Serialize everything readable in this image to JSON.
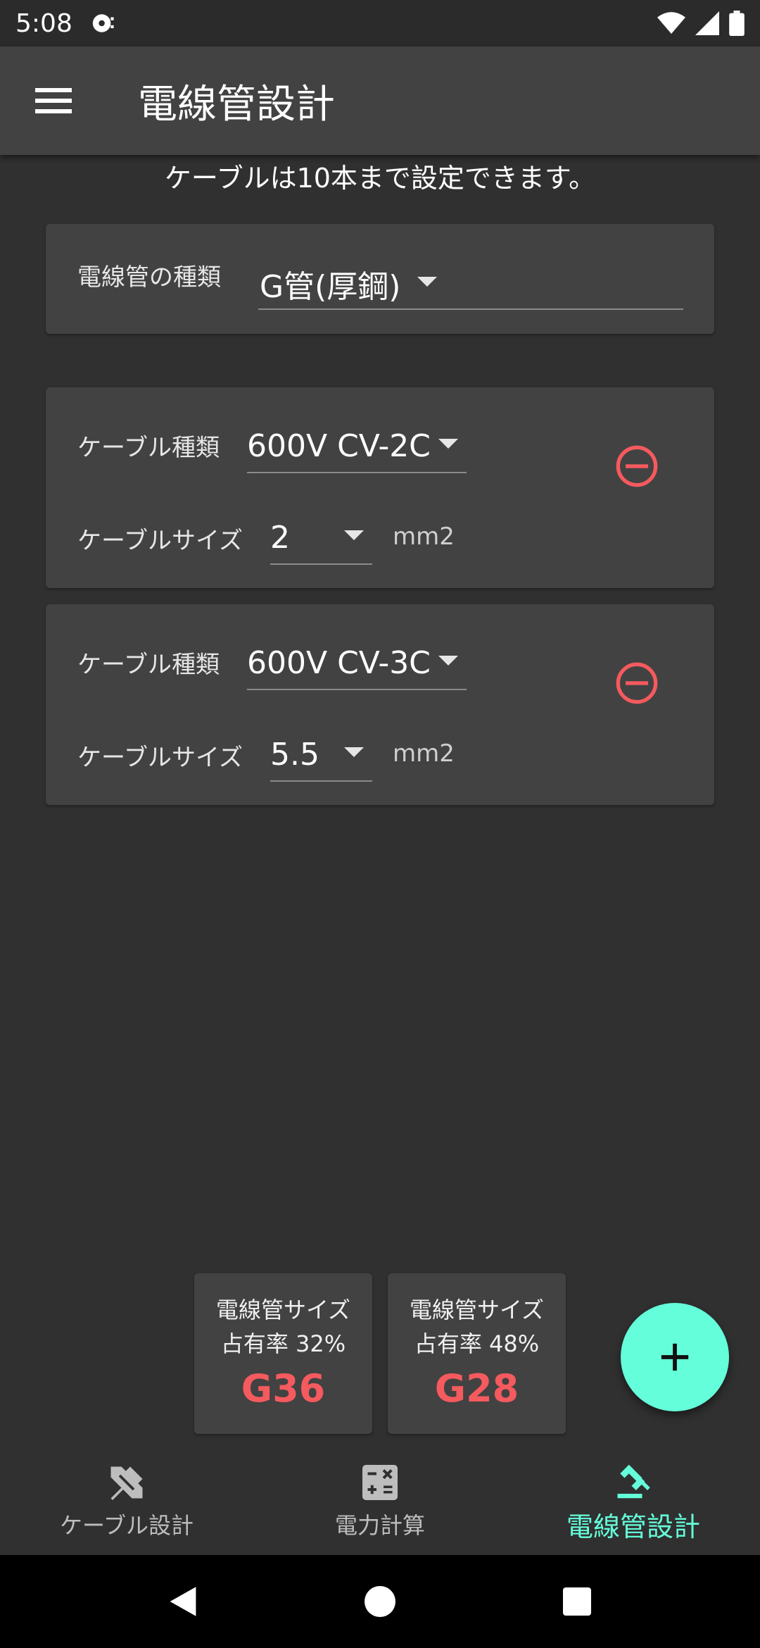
{
  "status_bar": {
    "time": "5:08"
  },
  "app_bar": {
    "title": "電線管設計"
  },
  "info": {
    "text": "ケーブルは10本まで設定できます。"
  },
  "conduit_card": {
    "label": "電線管の種類",
    "value": "G管(厚鋼)"
  },
  "cables": [
    {
      "type_label": "ケーブル種類",
      "type_value": "600V CV-2C",
      "size_label": "ケーブルサイズ",
      "size_value": "2",
      "unit": "mm2"
    },
    {
      "type_label": "ケーブル種類",
      "type_value": "600V CV-3C",
      "size_label": "ケーブルサイズ",
      "size_value": "5.5",
      "unit": "mm2"
    }
  ],
  "results": [
    {
      "title": "電線管サイズ",
      "rate": "占有率 32%",
      "size": "G36"
    },
    {
      "title": "電線管サイズ",
      "rate": "占有率 48%",
      "size": "G28"
    }
  ],
  "bottom_nav": [
    {
      "label": "ケーブル設計",
      "icon": "tools-icon"
    },
    {
      "label": "電力計算",
      "icon": "calculator-icon"
    },
    {
      "label": "電線管設計",
      "icon": "gavel-icon"
    }
  ],
  "colors": {
    "accent": "#64ffda",
    "danger": "#f55a5e",
    "background": "#303030",
    "surface": "#424242"
  }
}
